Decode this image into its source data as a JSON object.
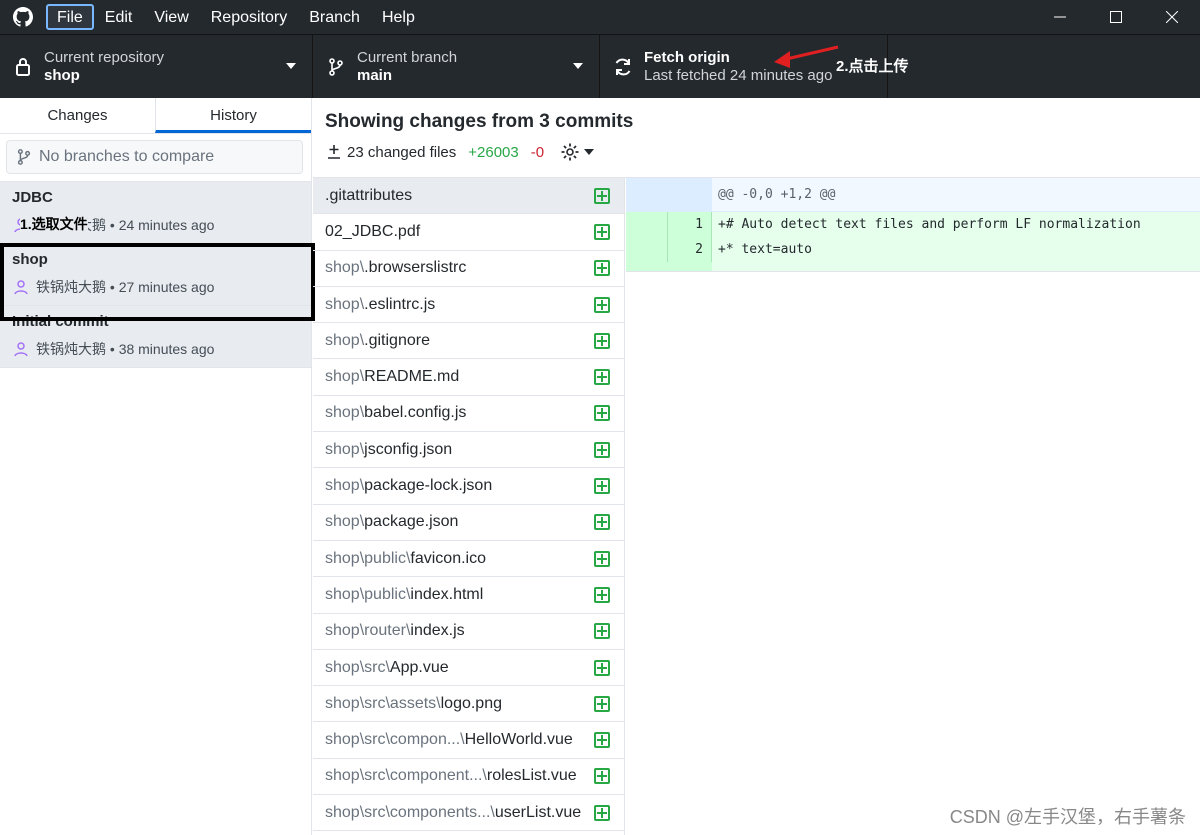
{
  "menu": {
    "items": [
      "File",
      "Edit",
      "View",
      "Repository",
      "Branch",
      "Help"
    ]
  },
  "toolbar": {
    "repo_label": "Current repository",
    "repo_value": "shop",
    "branch_label": "Current branch",
    "branch_value": "main",
    "fetch_label": "Fetch origin",
    "fetch_sub": "Last fetched 24 minutes ago"
  },
  "sidebar": {
    "tabs": [
      "Changes",
      "History"
    ],
    "selected_tab": "History",
    "compare_placeholder": "No branches to compare",
    "commits": [
      {
        "title": "JDBC",
        "author": "铁锅炖大鹅",
        "time": "24 minutes ago"
      },
      {
        "title": "shop",
        "author": "铁锅炖大鹅",
        "time": "27 minutes ago"
      },
      {
        "title": "Initial commit",
        "author": "铁锅炖大鹅",
        "time": "38 minutes ago"
      }
    ]
  },
  "main": {
    "heading": "Showing changes from 3 commits",
    "changed_files": "23 changed files",
    "additions": "+26003",
    "deletions": "-0"
  },
  "files": [
    {
      "dir": "",
      "base": ".gitattributes"
    },
    {
      "dir": "",
      "base": "02_JDBC.pdf"
    },
    {
      "dir": "shop\\",
      "base": ".browserslistrc"
    },
    {
      "dir": "shop\\",
      "base": ".eslintrc.js"
    },
    {
      "dir": "shop\\",
      "base": ".gitignore"
    },
    {
      "dir": "shop\\",
      "base": "README.md"
    },
    {
      "dir": "shop\\",
      "base": "babel.config.js"
    },
    {
      "dir": "shop\\",
      "base": "jsconfig.json"
    },
    {
      "dir": "shop\\",
      "base": "package-lock.json"
    },
    {
      "dir": "shop\\",
      "base": "package.json"
    },
    {
      "dir": "shop\\public\\",
      "base": "favicon.ico"
    },
    {
      "dir": "shop\\public\\",
      "base": "index.html"
    },
    {
      "dir": "shop\\router\\",
      "base": "index.js"
    },
    {
      "dir": "shop\\src\\",
      "base": "App.vue"
    },
    {
      "dir": "shop\\src\\assets\\",
      "base": "logo.png"
    },
    {
      "dir": "shop\\src\\compon...\\",
      "base": "HelloWorld.vue"
    },
    {
      "dir": "shop\\src\\component...\\",
      "base": "rolesList.vue"
    },
    {
      "dir": "shop\\src\\components...\\",
      "base": "userList.vue"
    }
  ],
  "diff": {
    "hunk": "@@ -0,0 +1,2 @@",
    "lines": [
      {
        "num": "1",
        "code": "+# Auto detect text files and perform LF normalization"
      },
      {
        "num": "2",
        "code": "+* text=auto"
      }
    ]
  },
  "annotations": {
    "step1": "1.选取文件",
    "step2": "2.点击上传",
    "watermark": "CSDN @左手汉堡，右手薯条"
  },
  "colors": {
    "toolbar_bg": "#24292e",
    "accent": "#0366d6",
    "added": "#28a745",
    "deleted": "#cb2431"
  }
}
